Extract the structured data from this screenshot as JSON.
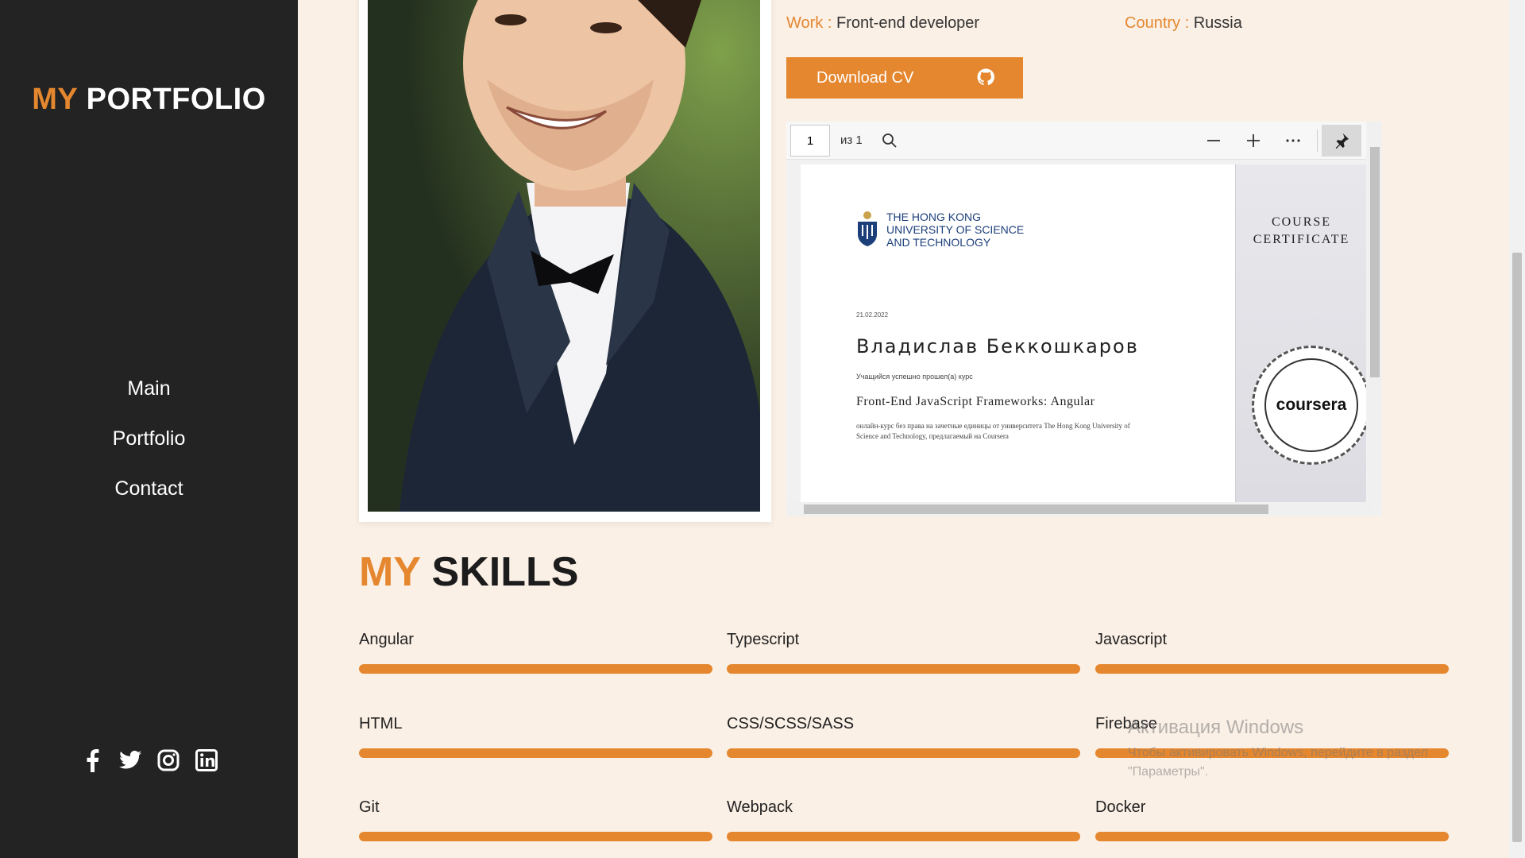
{
  "sidebar": {
    "logo_accent": "MY",
    "logo_main": "PORTFOLIO",
    "nav": [
      "Main",
      "Portfolio",
      "Contact"
    ],
    "socials": [
      "facebook-icon",
      "twitter-icon",
      "instagram-icon",
      "linkedin-icon"
    ]
  },
  "profile": {
    "work_label": "Work :",
    "work_value": "Front-end developer",
    "country_label": "Country :",
    "country_value": "Russia",
    "download_label": "Download CV"
  },
  "pdf": {
    "page_value": "1",
    "page_of": "из 1",
    "certificate": {
      "university": "THE HONG KONG UNIVERSITY OF SCIENCE AND TECHNOLOGY",
      "side_title_1": "COURSE",
      "side_title_2": "CERTIFICATE",
      "date": "21.02.2022",
      "name": "Владислав Беккошкаров",
      "passed": "Учащийся успешно прошел(а) курс",
      "course": "Front-End JavaScript Frameworks: Angular",
      "description": "онлайн-курс без права на зачетные единицы от университета The Hong Kong University of Science and Technology, предлагаемый на Coursera",
      "seal_word": "coursera"
    }
  },
  "skills": {
    "title_accent": "MY",
    "title_main": "SKILLS",
    "items": [
      "Angular",
      "Typescript",
      "Javascript",
      "HTML",
      "CSS/SCSS/SASS",
      "Firebase",
      "Git",
      "Webpack",
      "Docker"
    ]
  },
  "watermark": {
    "title": "Активация Windows",
    "text": "Чтобы активировать Windows, перейдите в раздел \"Параметры\"."
  },
  "colors": {
    "accent": "#e5872f",
    "sidebar_bg": "#232323",
    "page_bg": "#fbf0e6"
  }
}
